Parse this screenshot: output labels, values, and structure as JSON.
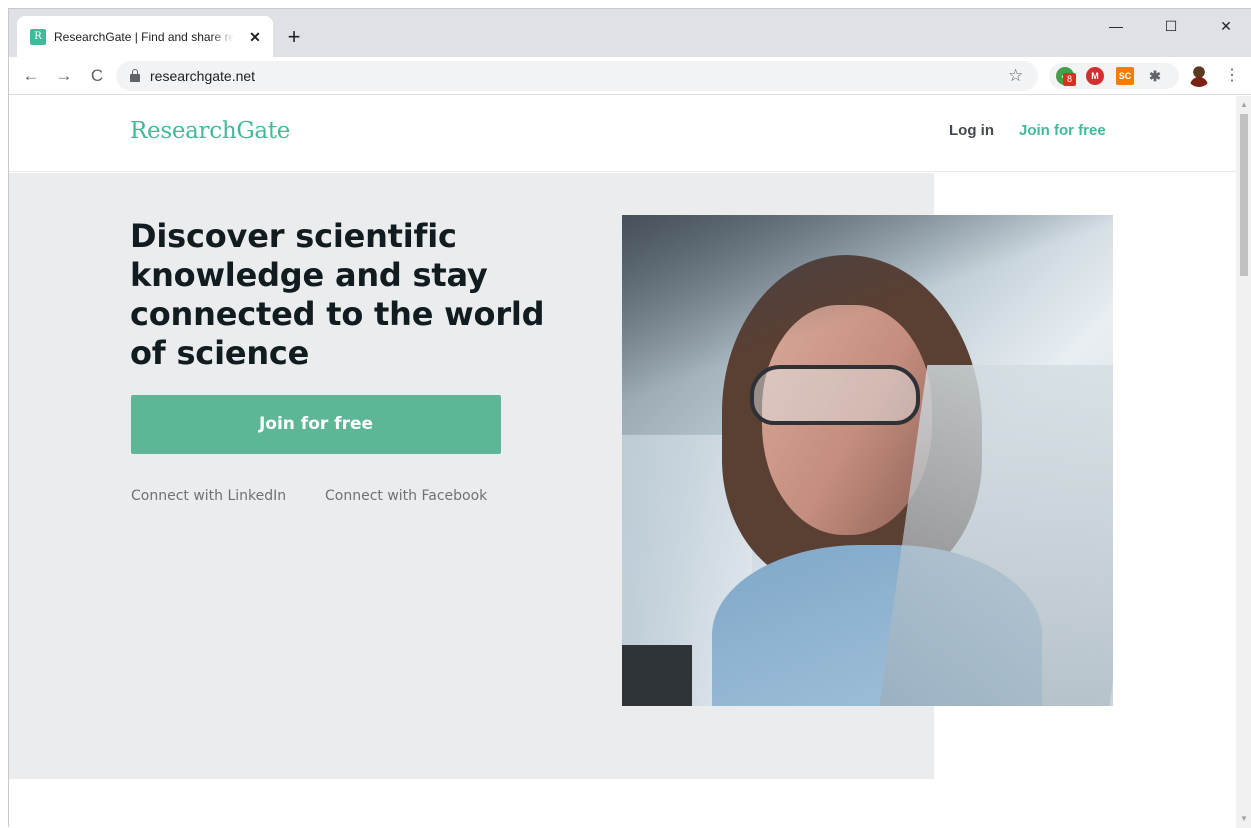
{
  "browser": {
    "tab": {
      "favicon_text": "R",
      "title": "ResearchGate | Find and share research",
      "close_glyph": "✕"
    },
    "new_tab_glyph": "+",
    "window_controls": {
      "minimize": "—",
      "maximize": "☐",
      "close": "✕"
    },
    "nav": {
      "back": "←",
      "forward": "→",
      "reload": "C"
    },
    "url": "researchgate.net",
    "bookmark_glyph": "☆",
    "extensions": [
      {
        "name": "check-extension",
        "label": "✔",
        "badge": "8",
        "color": "#43a047"
      },
      {
        "name": "m-extension",
        "label": "M",
        "color": "#d32f2f"
      },
      {
        "name": "sc-extension",
        "label": "SC",
        "color": "#f57c00"
      },
      {
        "name": "puzzle-extension",
        "label": "✱",
        "color": "#5f6368"
      }
    ],
    "menu_glyph": "⋮"
  },
  "header": {
    "logo": "ResearchGate",
    "login": "Log in",
    "join": "Join for free"
  },
  "hero": {
    "headline": "Discover scientific knowledge and stay connected to the world of science",
    "cta": "Join for free",
    "linkedin": "Connect with LinkedIn",
    "facebook": "Connect with Facebook"
  },
  "colors": {
    "brand": "#40ba9b",
    "cta_background": "#5db797",
    "hero_background": "#ebeced",
    "headline": "#111c20"
  }
}
